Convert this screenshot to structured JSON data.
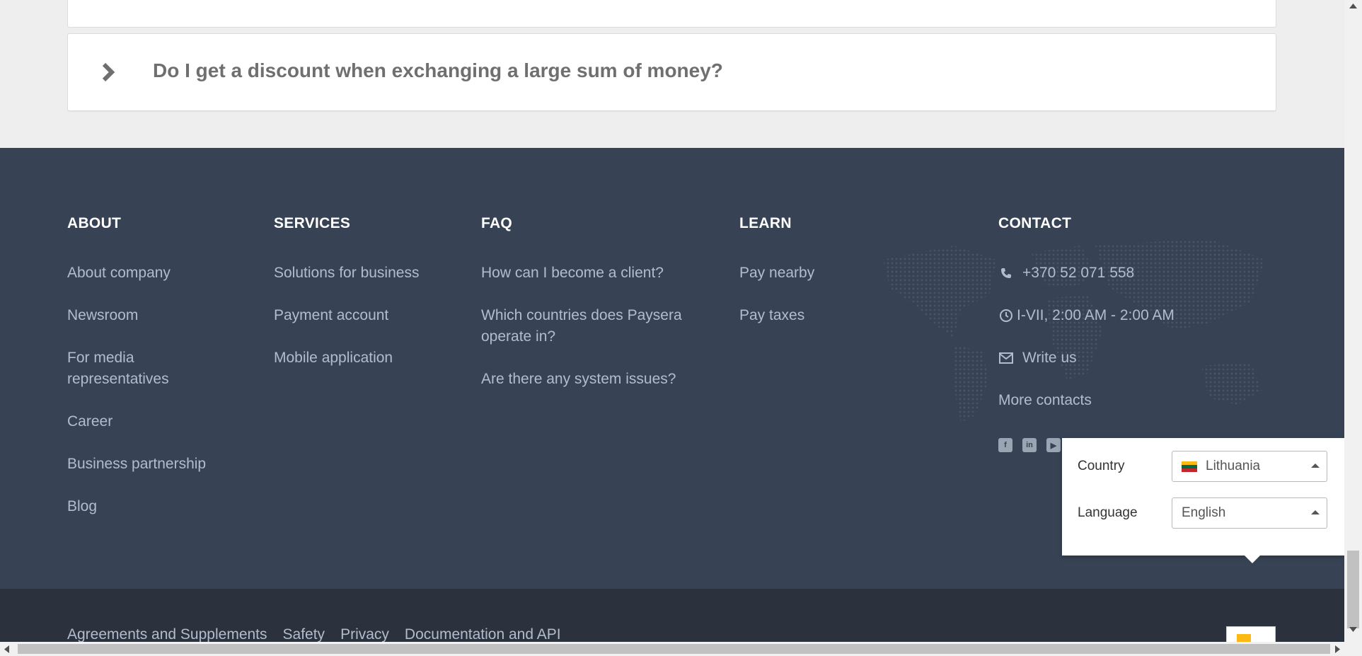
{
  "faq": {
    "question": "Do I get a discount when exchanging a large sum of money?"
  },
  "footer": {
    "about": {
      "title": "ABOUT",
      "items": [
        "About company",
        "Newsroom",
        "For media representatives",
        "Career",
        "Business partnership",
        "Blog"
      ]
    },
    "services": {
      "title": "SERVICES",
      "items": [
        "Solutions for business",
        "Payment account",
        "Mobile application"
      ]
    },
    "faq": {
      "title": "FAQ",
      "items": [
        "How can I become a client?",
        "Which countries does Paysera operate in?",
        "Are there any system issues?"
      ]
    },
    "learn": {
      "title": "LEARN",
      "items": [
        "Pay nearby",
        "Pay taxes"
      ]
    },
    "contact": {
      "title": "CONTACT",
      "phone": "+370 52 071 558",
      "hours": "I-VII, 2:00 AM - 2:00 AM",
      "write": "Write us",
      "more": "More contacts"
    },
    "social_icons": [
      "facebook-icon",
      "linkedin-icon",
      "youtube-icon"
    ],
    "colors": {
      "background": "#374354",
      "heading": "#ffffff",
      "link": "#b2bccb"
    }
  },
  "bottom": {
    "links": [
      "Agreements and Supplements",
      "Safety",
      "Privacy",
      "Documentation and API"
    ]
  },
  "locale_popup": {
    "country_label": "Country",
    "country_value": "Lithuania",
    "language_label": "Language",
    "language_value": "English",
    "flag_colors": [
      "#fdb913",
      "#006a44",
      "#c1272d"
    ]
  }
}
